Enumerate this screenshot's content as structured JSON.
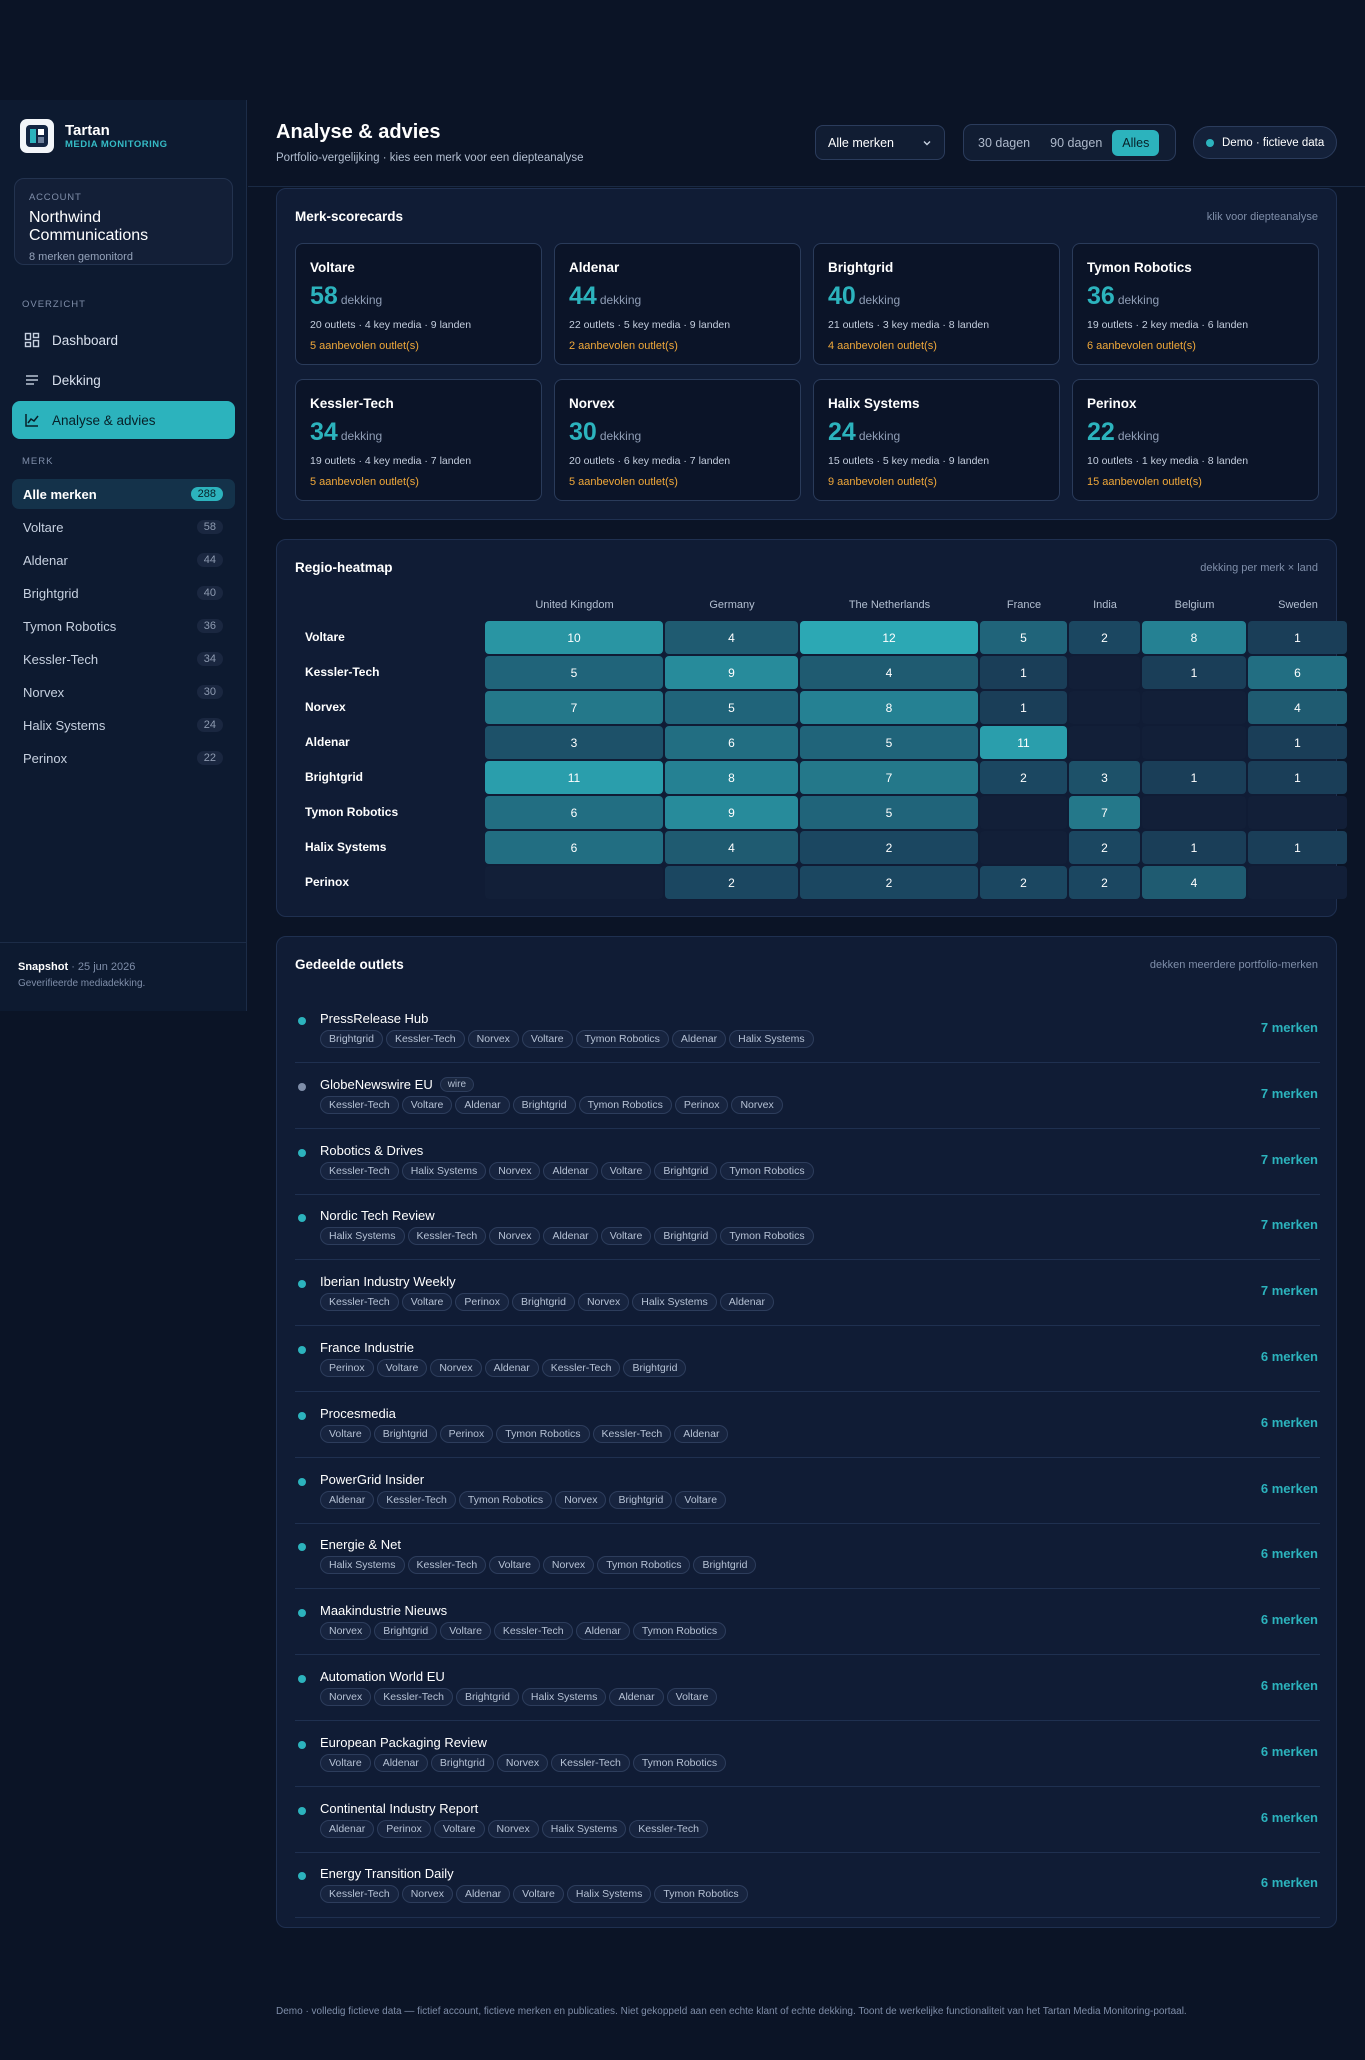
{
  "brand": {
    "name": "Tartan",
    "sub": "MEDIA MONITORING"
  },
  "account": {
    "label": "ACCOUNT",
    "name": "Northwind Communications",
    "sub": "8 merken gemonitord"
  },
  "sidebar": {
    "overview_label": "OVERZICHT",
    "nav": [
      {
        "label": "Dashboard",
        "icon": "dashboard-icon"
      },
      {
        "label": "Dekking",
        "icon": "list-icon"
      },
      {
        "label": "Analyse & advies",
        "icon": "chart-icon"
      }
    ],
    "brands_label": "MERK",
    "brands": [
      {
        "name": "Alle merken",
        "count": "288"
      },
      {
        "name": "Voltare",
        "count": "58"
      },
      {
        "name": "Aldenar",
        "count": "44"
      },
      {
        "name": "Brightgrid",
        "count": "40"
      },
      {
        "name": "Tymon Robotics",
        "count": "36"
      },
      {
        "name": "Kessler-Tech",
        "count": "34"
      },
      {
        "name": "Norvex",
        "count": "30"
      },
      {
        "name": "Halix Systems",
        "count": "24"
      },
      {
        "name": "Perinox",
        "count": "22"
      }
    ],
    "footer_title": "Snapshot",
    "footer_date": "· 25 jun 2026",
    "footer_sub": "Geverifieerde mediadekking."
  },
  "header": {
    "title": "Analyse & advies",
    "subtitle": "Portfolio-vergelijking · kies een merk voor een diepteanalyse",
    "select_value": "Alle merken",
    "ranges": [
      "30 dagen",
      "90 dagen",
      "Alles"
    ],
    "demo": "Demo · fictieve data"
  },
  "scorecards": {
    "title": "Merk-scorecards",
    "note": "klik voor diepteanalyse",
    "unit": "dekking",
    "cards": [
      {
        "name": "Voltare",
        "value": "58",
        "meta": "20 outlets · 4 key media · 9 landen",
        "rec": "5 aanbevolen outlet(s)"
      },
      {
        "name": "Aldenar",
        "value": "44",
        "meta": "22 outlets · 5 key media · 9 landen",
        "rec": "2 aanbevolen outlet(s)"
      },
      {
        "name": "Brightgrid",
        "value": "40",
        "meta": "21 outlets · 3 key media · 8 landen",
        "rec": "4 aanbevolen outlet(s)"
      },
      {
        "name": "Tymon Robotics",
        "value": "36",
        "meta": "19 outlets · 2 key media · 6 landen",
        "rec": "6 aanbevolen outlet(s)"
      },
      {
        "name": "Kessler-Tech",
        "value": "34",
        "meta": "19 outlets · 4 key media · 7 landen",
        "rec": "5 aanbevolen outlet(s)"
      },
      {
        "name": "Norvex",
        "value": "30",
        "meta": "20 outlets · 6 key media · 7 landen",
        "rec": "5 aanbevolen outlet(s)"
      },
      {
        "name": "Halix Systems",
        "value": "24",
        "meta": "15 outlets · 5 key media · 9 landen",
        "rec": "9 aanbevolen outlet(s)"
      },
      {
        "name": "Perinox",
        "value": "22",
        "meta": "10 outlets · 1 key media · 8 landen",
        "rec": "15 aanbevolen outlet(s)"
      }
    ]
  },
  "heatmap": {
    "title": "Regio-heatmap",
    "note": "dekking per merk × land",
    "countries": [
      "United Kingdom",
      "Germany",
      "The Netherlands",
      "France",
      "India",
      "Belgium",
      "Sweden"
    ],
    "rows": [
      {
        "brand": "Voltare",
        "values": [
          10,
          4,
          12,
          5,
          2,
          8,
          1
        ]
      },
      {
        "brand": "Kessler-Tech",
        "values": [
          5,
          9,
          4,
          1,
          null,
          1,
          6
        ]
      },
      {
        "brand": "Norvex",
        "values": [
          7,
          5,
          8,
          1,
          null,
          null,
          4
        ]
      },
      {
        "brand": "Aldenar",
        "values": [
          3,
          6,
          5,
          11,
          null,
          null,
          1
        ]
      },
      {
        "brand": "Brightgrid",
        "values": [
          11,
          8,
          7,
          2,
          3,
          1,
          1
        ]
      },
      {
        "brand": "Tymon Robotics",
        "values": [
          6,
          9,
          5,
          null,
          7,
          null,
          null
        ]
      },
      {
        "brand": "Halix Systems",
        "values": [
          6,
          4,
          2,
          null,
          2,
          1,
          1
        ]
      },
      {
        "brand": "Perinox",
        "values": [
          null,
          2,
          2,
          2,
          2,
          4,
          null
        ]
      }
    ]
  },
  "outlets": {
    "title": "Gedeelde outlets",
    "note": "dekken meerdere portfolio-merken",
    "items": [
      {
        "name": "PressRelease Hub",
        "tags": [
          "Brightgrid",
          "Kessler-Tech",
          "Norvex",
          "Voltare",
          "Tymon Robotics",
          "Aldenar",
          "Halix Systems"
        ],
        "count": "7 merken"
      },
      {
        "name": "GlobeNewswire EU",
        "badge": "wire",
        "tags": [
          "Kessler-Tech",
          "Voltare",
          "Aldenar",
          "Brightgrid",
          "Tymon Robotics",
          "Perinox",
          "Norvex"
        ],
        "count": "7 merken"
      },
      {
        "name": "Robotics & Drives",
        "tags": [
          "Kessler-Tech",
          "Halix Systems",
          "Norvex",
          "Aldenar",
          "Voltare",
          "Brightgrid",
          "Tymon Robotics"
        ],
        "count": "7 merken"
      },
      {
        "name": "Nordic Tech Review",
        "tags": [
          "Halix Systems",
          "Kessler-Tech",
          "Norvex",
          "Aldenar",
          "Voltare",
          "Brightgrid",
          "Tymon Robotics"
        ],
        "count": "7 merken"
      },
      {
        "name": "Iberian Industry Weekly",
        "tags": [
          "Kessler-Tech",
          "Voltare",
          "Perinox",
          "Brightgrid",
          "Norvex",
          "Halix Systems",
          "Aldenar"
        ],
        "count": "7 merken"
      },
      {
        "name": "France Industrie",
        "tags": [
          "Perinox",
          "Voltare",
          "Norvex",
          "Aldenar",
          "Kessler-Tech",
          "Brightgrid"
        ],
        "count": "6 merken"
      },
      {
        "name": "Procesmedia",
        "tags": [
          "Voltare",
          "Brightgrid",
          "Perinox",
          "Tymon Robotics",
          "Kessler-Tech",
          "Aldenar"
        ],
        "count": "6 merken"
      },
      {
        "name": "PowerGrid Insider",
        "tags": [
          "Aldenar",
          "Kessler-Tech",
          "Tymon Robotics",
          "Norvex",
          "Brightgrid",
          "Voltare"
        ],
        "count": "6 merken"
      },
      {
        "name": "Energie & Net",
        "tags": [
          "Halix Systems",
          "Kessler-Tech",
          "Voltare",
          "Norvex",
          "Tymon Robotics",
          "Brightgrid"
        ],
        "count": "6 merken"
      },
      {
        "name": "Maakindustrie Nieuws",
        "tags": [
          "Norvex",
          "Brightgrid",
          "Voltare",
          "Kessler-Tech",
          "Aldenar",
          "Tymon Robotics"
        ],
        "count": "6 merken"
      },
      {
        "name": "Automation World EU",
        "tags": [
          "Norvex",
          "Kessler-Tech",
          "Brightgrid",
          "Halix Systems",
          "Aldenar",
          "Voltare"
        ],
        "count": "6 merken"
      },
      {
        "name": "European Packaging Review",
        "tags": [
          "Voltare",
          "Aldenar",
          "Brightgrid",
          "Norvex",
          "Kessler-Tech",
          "Tymon Robotics"
        ],
        "count": "6 merken"
      },
      {
        "name": "Continental Industry Report",
        "tags": [
          "Aldenar",
          "Perinox",
          "Voltare",
          "Norvex",
          "Halix Systems",
          "Kessler-Tech"
        ],
        "count": "6 merken"
      },
      {
        "name": "Energy Transition Daily",
        "tags": [
          "Kessler-Tech",
          "Norvex",
          "Aldenar",
          "Voltare",
          "Halix Systems",
          "Tymon Robotics"
        ],
        "count": "6 merken"
      }
    ]
  },
  "footer": "Demo · volledig fictieve data — fictief account, fictieve merken en publicaties. Niet gekoppeld aan een echte klant of echte dekking. Toont de werkelijke functionaliteit van het Tartan Media Monitoring-portaal."
}
